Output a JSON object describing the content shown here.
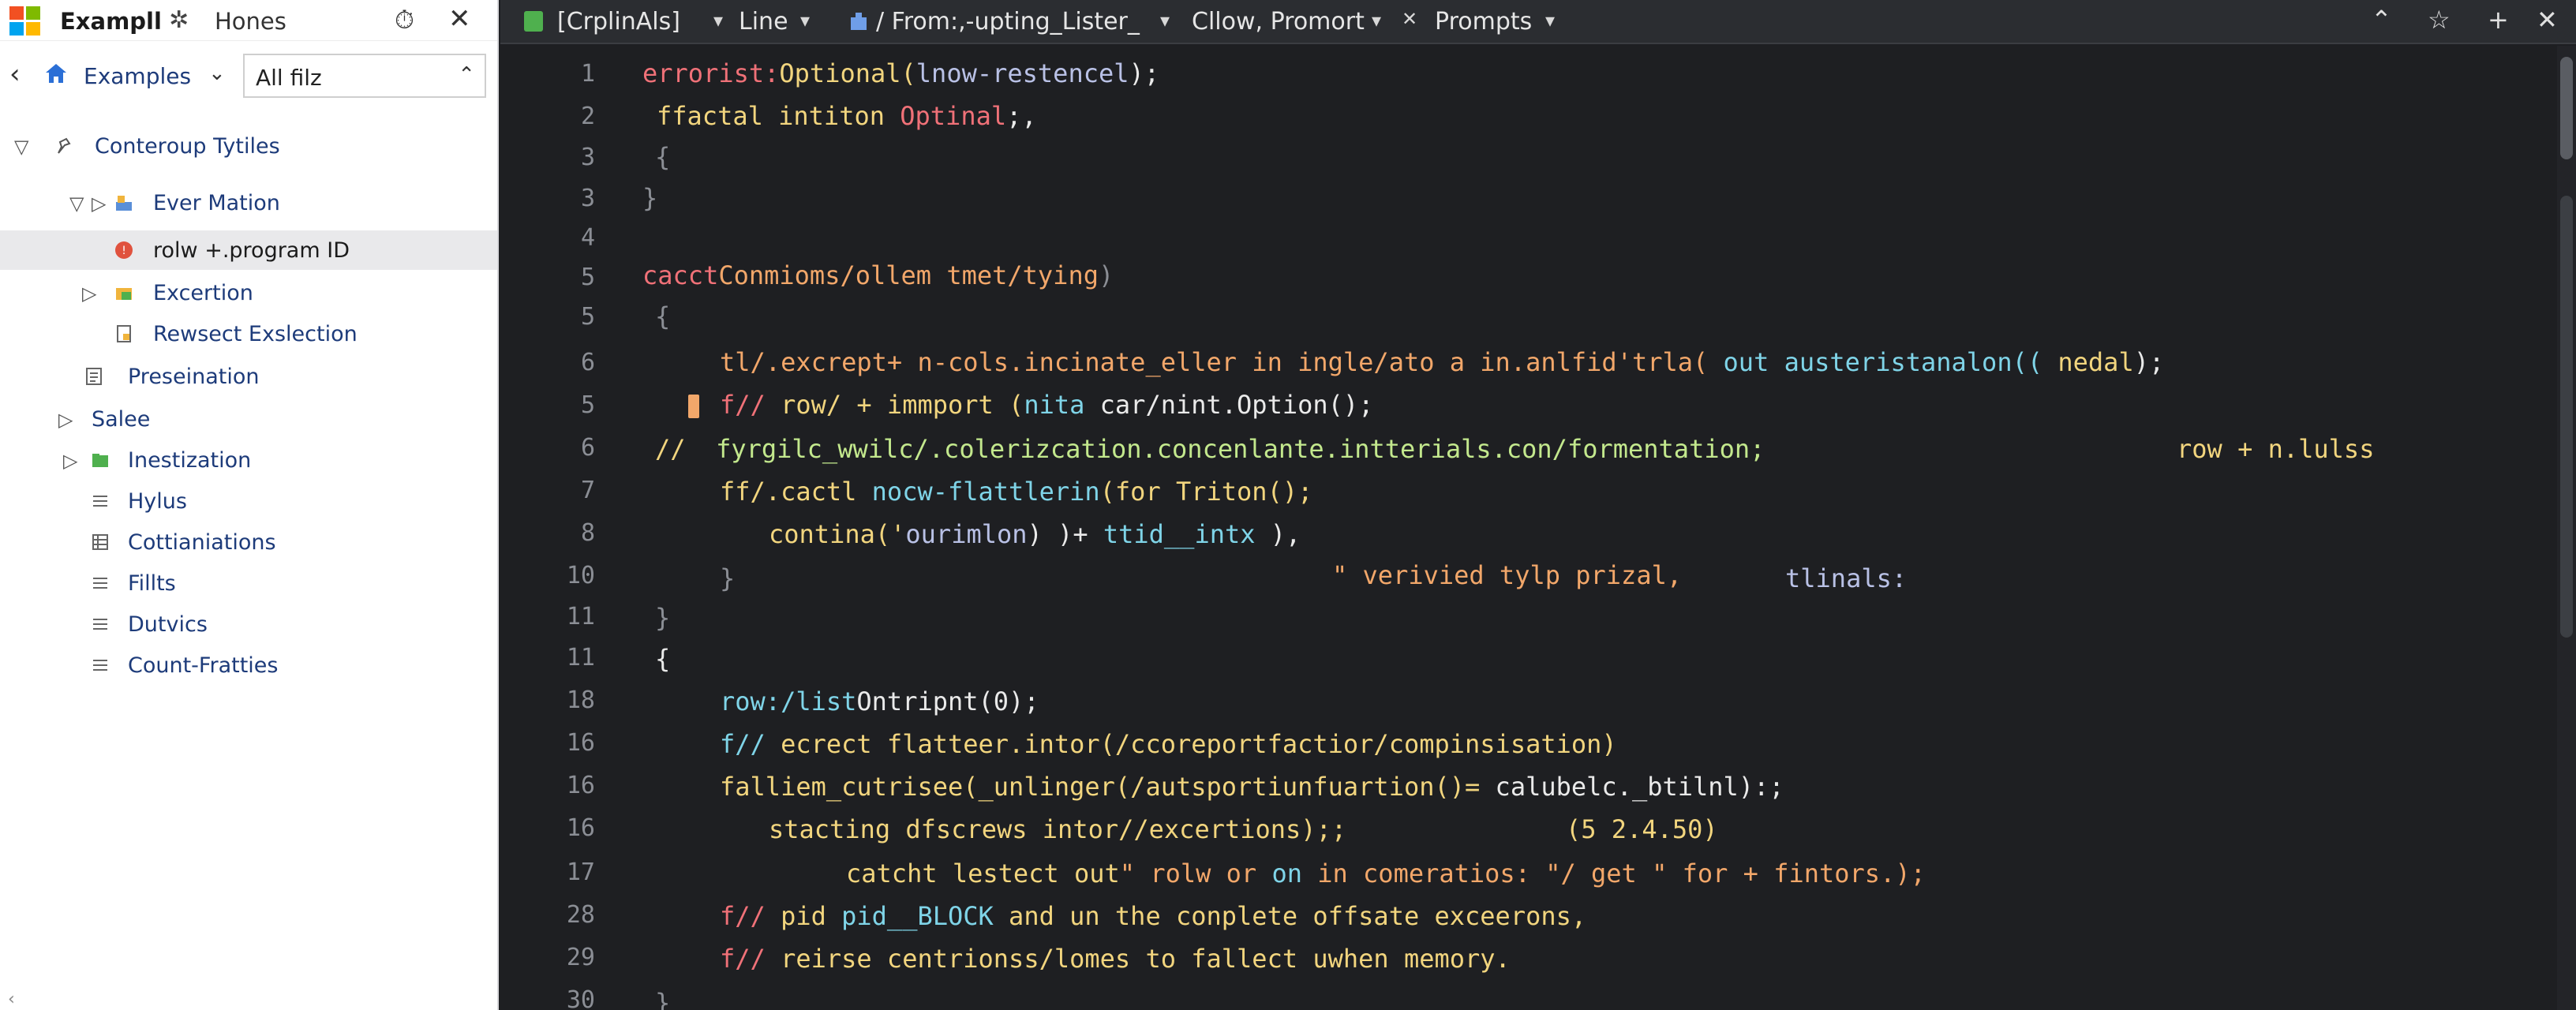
{
  "left_panel": {
    "title": "Exampll",
    "hones_label": "Hones",
    "nav_location": "Examples",
    "filter_value": "All filz",
    "tree": [
      {
        "label": "Conterоup Tytiles"
      },
      {
        "label": "Ever Mation"
      },
      {
        "label": "rolw +.program ID"
      },
      {
        "label": "Excertion"
      },
      {
        "label": "Rewsect Exslection"
      },
      {
        "label": "Preseination"
      },
      {
        "label": "Salee"
      },
      {
        "label": "Inestization"
      },
      {
        "label": "Hylus"
      },
      {
        "label": "Cottianiations"
      },
      {
        "label": "Fillts"
      },
      {
        "label": "Dutvics"
      },
      {
        "label": "Count-Fratties"
      }
    ]
  },
  "tab_bar": {
    "t1": "[CrplinAls]",
    "t2": "Line",
    "t3": "/ From:,-upting_Lister_",
    "t4": "Cllow, Promort",
    "t5": "Prompts"
  },
  "editor": {
    "line_numbers": [
      "1",
      "2",
      "3",
      "3",
      "4",
      "5",
      "5",
      "6",
      "5",
      "6",
      "7",
      "8",
      "10",
      "11",
      "11",
      "18",
      "16",
      "16",
      "16",
      "17",
      "28",
      "29",
      "30"
    ],
    "l01a": "errorist:",
    "l01b": "Optional(",
    "l01c": "lnow-restencel",
    "l01d": ");",
    "l02a": "ffactal intiton ",
    "l02b": "Optinal",
    "l02c": ";,",
    "l03": "{",
    "l04": "}",
    "l05a": "cacct",
    "l05b": "Conmioms/ollem tmet/tying",
    "l05c": ")",
    "l06": "{",
    "l07a": "tl/.excrept+ n-cols.incinate_eller in ingle/ato a in.anlfid'trla( ",
    "l07b": "out austeristanalon((",
    "l07c": " ",
    "l07d": "nedal",
    "l07e": ");",
    "l08a": "f// ",
    "l08b": "row/ + immport (",
    "l08c": "nita",
    "l08d": " car/nint.Option();",
    "l09a": "//",
    "l09b": "  fyrgilc_wwilc/.colerizcation.concenlante.intterials.con/formentation;",
    "l09c": "row + n.lulss",
    "l10a": "ff/.cactl ",
    "l10b": "nocw-flattlerin",
    "l10c": "(for Triton();",
    "l11a": "contina('",
    "l11b": "ourimlon",
    "l11c": ") )+ ",
    "l11d": "ttid__intx",
    "l11e": " ),",
    "l12a": "}",
    "l12b": "\" verivied tylp prizal,",
    "l12c": "tlinals:",
    "l13": "}",
    "l14": "{",
    "l15a": "row:/list",
    "l15b": "Ontripnt(0);",
    "l16a": "f// ",
    "l16b": "ecrect flatteer.intor(/ccoreportfactior/compinsisation)",
    "l17a": "falliem_cutrisee(_unlinger(/autsportiunfuartion()= ",
    "l17b": "calubelc._btilnl",
    "l17c": "):;",
    "l18a": "stacting dfscrews intor//excertions);;",
    "l18b": "(5 2.4.50)",
    "l19a": "catcht lestect out",
    "l19b": "\" rolw or ",
    "l19c": "on",
    "l19d": " in comeratiоs: \"/ get \" for + fintors.);",
    "l20a": "f// ",
    "l20b": "pid ",
    "l20c": "pid__BLOCK",
    "l20d": " and un the conplete offsate exceerons,",
    "l21a": "f// ",
    "l21b": "reirse centrionss/lomes to fallect uwhen memory.",
    "l22": "}"
  }
}
